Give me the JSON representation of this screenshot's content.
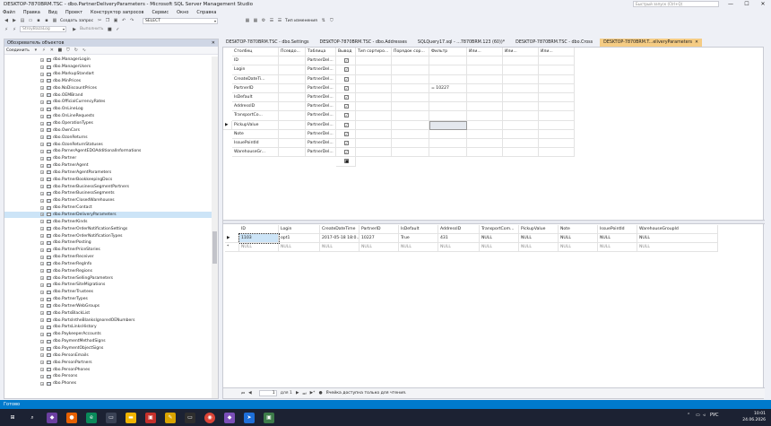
{
  "window": {
    "title": "DESKTOP-7870BRM.TSC - dbo.PartnerDeliveryParameters - Microsoft SQL Server Management Studio",
    "quick_search_placeholder": "Быстрый запуск (Ctrl+Q)",
    "minimize": "—",
    "maximize": "☐",
    "close": "✕"
  },
  "menu": [
    "Файл",
    "Правка",
    "Вид",
    "Проект",
    "Конструктор запросов",
    "Сервис",
    "Окно",
    "Справка"
  ],
  "toolbar": {
    "new_query_label": "Создать запрос",
    "select_combo_value": "SELECT",
    "change_type_label": "Тип изменения",
    "db_combo_value": "StroyBazaLog",
    "execute_label": "Выполнить"
  },
  "object_explorer": {
    "title": "Обозреватель объектов",
    "connect_label": "Соединить",
    "items": [
      "dbo.ManagerLogin",
      "dbo.ManagerUsers",
      "dbo.MarkupStandart",
      "dbo.MinPrices",
      "dbo.NoDiscountPrices",
      "dbo.OEMBrand",
      "dbo.OfficialCurrencyRates",
      "dbo.OnLineLog",
      "dbo.OnLineRequests",
      "dbo.OperationTypes",
      "dbo.OwnCars",
      "dbo.OzonReturns",
      "dbo.OzonReturnStatuses",
      "dbo.ParnerAgentEDOAdditionalInformations",
      "dbo.Partner",
      "dbo.PartnerAgent",
      "dbo.PartnerAgentParameters",
      "dbo.PartnerBookkeepingDocs",
      "dbo.PartnerBusinessSegmentPartners",
      "dbo.PartnerBusinessSegments",
      "dbo.PartnerClosedWarehouses",
      "dbo.PartnerContact",
      "dbo.PartnerDeliveryParameters",
      "dbo.PartnerKinds",
      "dbo.PartnerOrderNotificationSettings",
      "dbo.PartnerOrderNotificationTypes",
      "dbo.PartnerPosting",
      "dbo.PartnerPriceStories",
      "dbo.PartnerReceiver",
      "dbo.PartnerRegInfo",
      "dbo.PartnerRegions",
      "dbo.PartnerSellingParameters",
      "dbo.PartnerSiteMigrations",
      "dbo.PartnerTrustees",
      "dbo.PartnerTypes",
      "dbo.PartnerWebGroups",
      "dbo.PartsBlackList",
      "dbo.PartsIntheBlanksIgnoredOENumbers",
      "dbo.PartsLinksHistory",
      "dbo.PaykeeperAccounts",
      "dbo.PaymentMethodSigns",
      "dbo.PaymentObjectSigns",
      "dbo.PersonEmails",
      "dbo.PersonPartners",
      "dbo.PersonPhones",
      "dbo.Persons",
      "dbo.Phones"
    ],
    "selected_index": 22
  },
  "tabs": [
    {
      "label": "DESKTOP-7870BRM.TSC - dbo.Settings",
      "active": false
    },
    {
      "label": "DESKTOP-7870BRM.TSC - dbo.Addresses",
      "active": false
    },
    {
      "label": "SQLQuery17.sql - ...7870BRM.123 (60))*",
      "active": false
    },
    {
      "label": "DESKTOP-7870BRM.TSC - dbo.Cross",
      "active": false
    },
    {
      "label": "DESKTOP-7870BRM.T...eliveryParameters",
      "active": true
    }
  ],
  "criteria_grid": {
    "headers": [
      "Столбец",
      "Псевдо...",
      "Таблица",
      "Вывод",
      "Тип сортиро...",
      "Порядок сор...",
      "Фильтр",
      "Или...",
      "Или...",
      "Или..."
    ],
    "rows": [
      {
        "column": "ID",
        "table": "PartnerDel...",
        "output": true,
        "filter": ""
      },
      {
        "column": "Login",
        "table": "PartnerDel...",
        "output": true,
        "filter": ""
      },
      {
        "column": "CreateDateTi...",
        "table": "PartnerDel...",
        "output": true,
        "filter": ""
      },
      {
        "column": "PartnerID",
        "table": "PartnerDel...",
        "output": true,
        "filter": "= 10227"
      },
      {
        "column": "IsDefault",
        "table": "PartnerDel...",
        "output": true,
        "filter": ""
      },
      {
        "column": "AddressID",
        "table": "PartnerDel...",
        "output": true,
        "filter": ""
      },
      {
        "column": "TransportCo...",
        "table": "PartnerDel...",
        "output": true,
        "filter": ""
      },
      {
        "column": "PickupValue",
        "table": "PartnerDel...",
        "output": true,
        "filter": ""
      },
      {
        "column": "Note",
        "table": "PartnerDel...",
        "output": true,
        "filter": ""
      },
      {
        "column": "IssuePointId",
        "table": "PartnerDel...",
        "output": true,
        "filter": ""
      },
      {
        "column": "WarehouseGr...",
        "table": "PartnerDel...",
        "output": true,
        "filter": ""
      }
    ],
    "current_row_index": 7
  },
  "results_grid": {
    "headers": [
      "ID",
      "Login",
      "CreateDateTime",
      "PartnerID",
      "IsDefault",
      "AddressID",
      "TransportCom...",
      "PickupValue",
      "Note",
      "IssuePointId",
      "WarehouseGroupId"
    ],
    "rows": [
      [
        "1103",
        "opt1",
        "2017-05-18 18:0...",
        "10227",
        "True",
        "431",
        "NULL",
        "NULL",
        "NULL",
        "NULL",
        "NULL"
      ],
      [
        "NULL",
        "NULL",
        "NULL",
        "NULL",
        "NULL",
        "NULL",
        "NULL",
        "NULL",
        "NULL",
        "NULL",
        "NULL"
      ]
    ]
  },
  "navigator": {
    "current_page": "1",
    "of_label": "для 1",
    "status_text": "Ячейка доступна только для чтения."
  },
  "status_bar": {
    "text": "Готово"
  },
  "taskbar": {
    "language": "РУС",
    "time": "10:01",
    "date": "24.06.2026"
  }
}
